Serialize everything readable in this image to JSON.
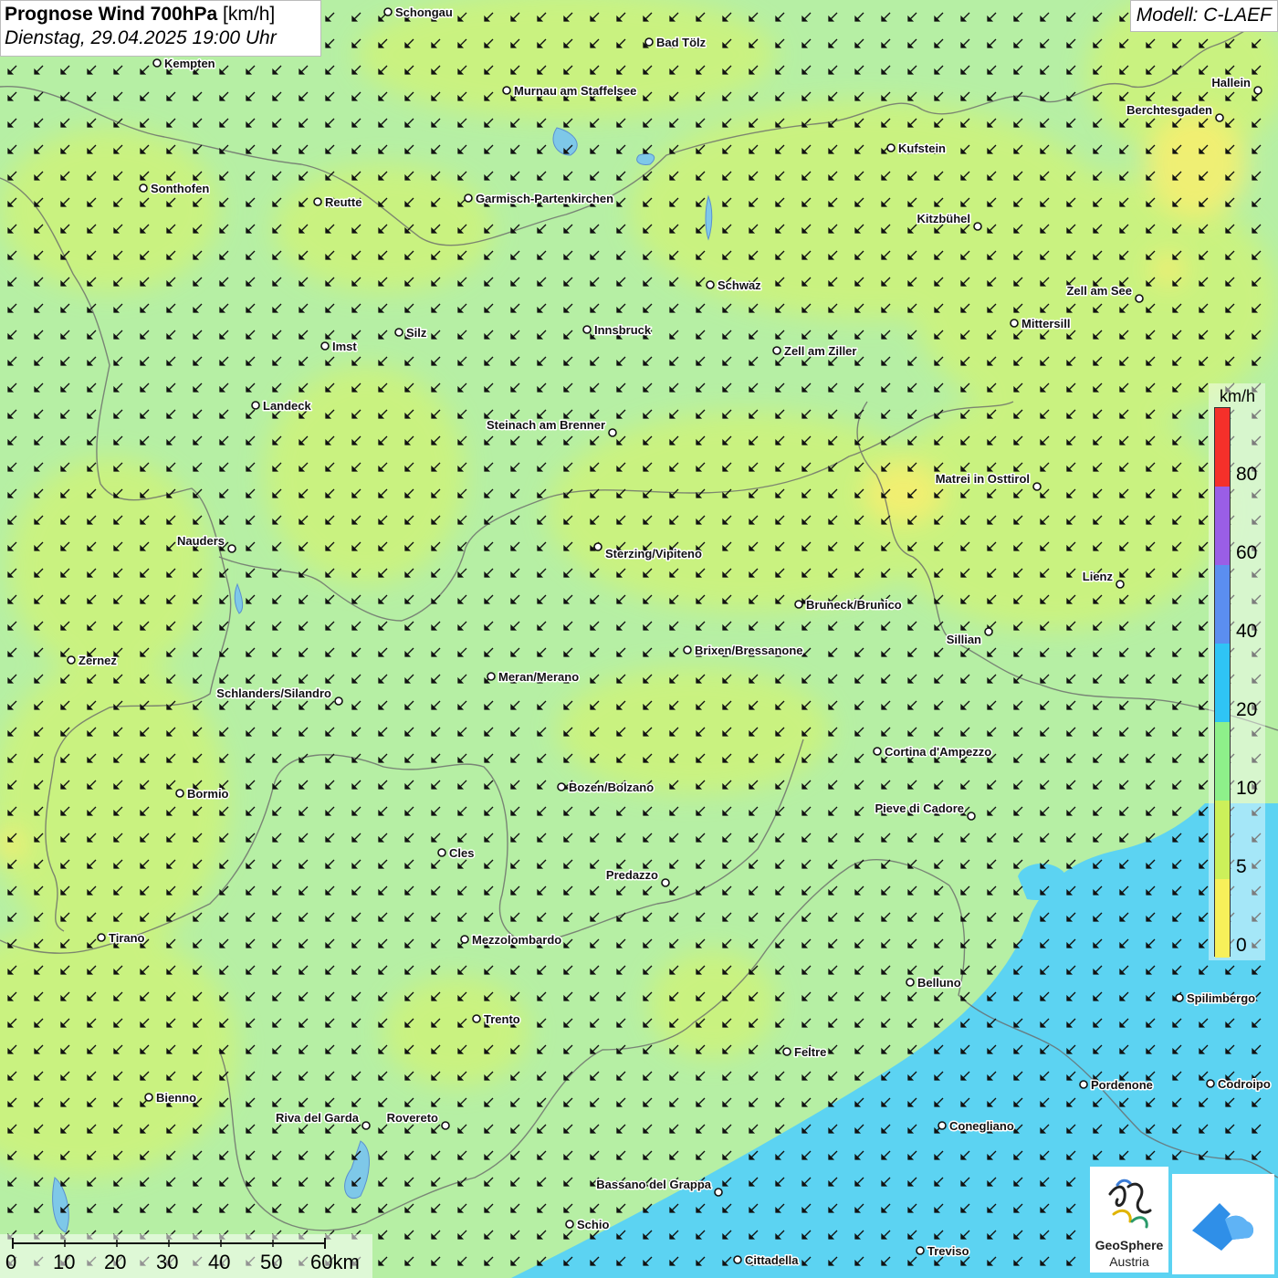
{
  "header": {
    "title_bold": "Prognose Wind 700hPa",
    "title_unit": "[km/h]",
    "datetime": "Dienstag, 29.04.2025 19:00 Uhr"
  },
  "model_label": "Modell: C-LAEF",
  "legend": {
    "unit": "km/h",
    "labels": [
      "80",
      "60",
      "40",
      "20",
      "10",
      "5",
      "0"
    ],
    "colors": [
      "#f5302a",
      "#9a5ee6",
      "#5b8ef0",
      "#2fc4f5",
      "#8ef08a",
      "#ccf05a",
      "#f7f05a"
    ]
  },
  "scalebar": {
    "labels": [
      "0",
      "10",
      "20",
      "30",
      "40",
      "50",
      "60km"
    ]
  },
  "logos": {
    "geosphere_line1": "GeoSphere",
    "geosphere_line2": "Austria",
    "geosphere_icon": "geosphere-logo-icon",
    "app_icon": "weather-app-logo-icon"
  },
  "wind_direction": "from north-east",
  "cities": [
    {
      "name": "Schongau"
    },
    {
      "name": "Bad Tölz"
    },
    {
      "name": "Kempten"
    },
    {
      "name": "Murnau am Staffelsee"
    },
    {
      "name": "Hallein"
    },
    {
      "name": "Berchtesgaden"
    },
    {
      "name": "Kufstein"
    },
    {
      "name": "Sonthofen"
    },
    {
      "name": "Reutte"
    },
    {
      "name": "Garmisch-Partenkirchen"
    },
    {
      "name": "Kitzbühel"
    },
    {
      "name": "Schwaz"
    },
    {
      "name": "Zell am See"
    },
    {
      "name": "Mittersill"
    },
    {
      "name": "Innsbruck"
    },
    {
      "name": "Silz"
    },
    {
      "name": "Imst"
    },
    {
      "name": "Zell am Ziller"
    },
    {
      "name": "Landeck"
    },
    {
      "name": "Steinach am Brenner"
    },
    {
      "name": "Matrei in Osttirol"
    },
    {
      "name": "Nauders"
    },
    {
      "name": "Sterzing/Vipiteno"
    },
    {
      "name": "Lienz"
    },
    {
      "name": "Bruneck/Brunico"
    },
    {
      "name": "Sillian"
    },
    {
      "name": "Brixen/Bressanone"
    },
    {
      "name": "Zernez"
    },
    {
      "name": "Meran/Merano"
    },
    {
      "name": "Schlanders/Silandro"
    },
    {
      "name": "Cortina d'Ampezzo"
    },
    {
      "name": "Bozen/Bolzano"
    },
    {
      "name": "Bormio"
    },
    {
      "name": "Pieve di Cadore"
    },
    {
      "name": "Cles"
    },
    {
      "name": "Predazzo"
    },
    {
      "name": "Tirano"
    },
    {
      "name": "Mezzolombardo"
    },
    {
      "name": "Belluno"
    },
    {
      "name": "Spilimbergo"
    },
    {
      "name": "Trento"
    },
    {
      "name": "Feltre"
    },
    {
      "name": "Pordenone"
    },
    {
      "name": "Codroipo"
    },
    {
      "name": "Bienno"
    },
    {
      "name": "Riva del Garda"
    },
    {
      "name": "Rovereto"
    },
    {
      "name": "Conegliano"
    },
    {
      "name": "Bassano del Grappa"
    },
    {
      "name": "Schio"
    },
    {
      "name": "Treviso"
    },
    {
      "name": "Cittadella"
    }
  ]
}
